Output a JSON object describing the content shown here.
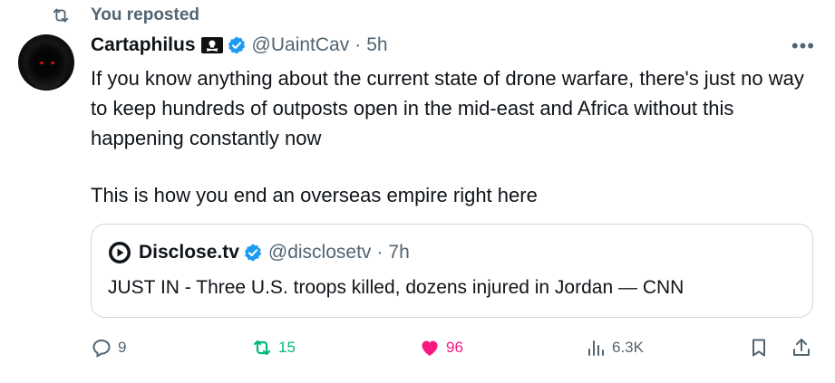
{
  "repost_label": "You reposted",
  "author": {
    "name": "Cartaphilus",
    "handle": "@UaintCav",
    "time": "5h"
  },
  "tweet": {
    "paragraphs": [
      "If you know anything about the current state of drone warfare, there's just no way to keep hundreds of outposts open in the mid-east and Africa without this happening constantly now",
      "This is how you end an overseas empire right here"
    ]
  },
  "quote": {
    "name": "Disclose.tv",
    "handle": "@disclosetv",
    "time": "7h",
    "text": "JUST IN - Three U.S. troops killed, dozens injured in Jordan — CNN"
  },
  "actions": {
    "replies": "9",
    "reposts": "15",
    "likes": "96",
    "views": "6.3K"
  },
  "colors": {
    "accent": "#1d9bf0",
    "retweet": "#00ba7c",
    "like": "#f91880",
    "muted": "#536471"
  }
}
